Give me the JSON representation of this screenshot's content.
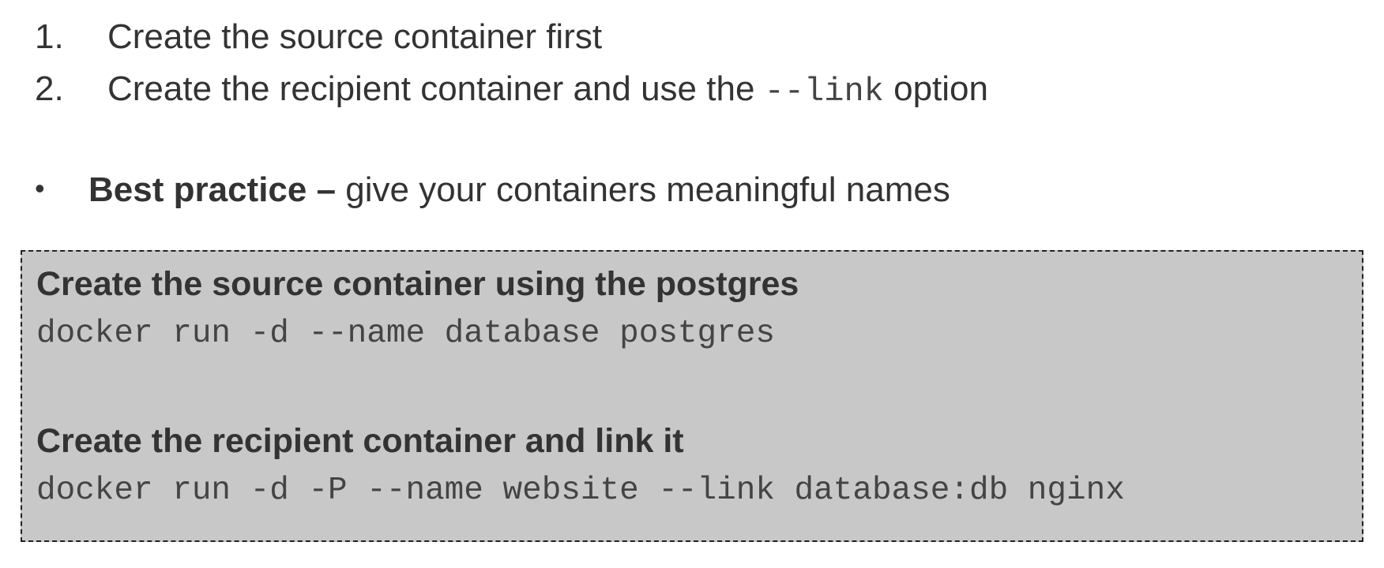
{
  "steps": [
    {
      "number": "1.",
      "text": "Create the source container first"
    },
    {
      "number": "2.",
      "text_before": "Create the recipient container and use the ",
      "code": "--link",
      "text_after": " option"
    }
  ],
  "bullet": {
    "symbol": "•",
    "bold": "Best practice –",
    "text": " give your containers meaningful names"
  },
  "code_box": {
    "blocks": [
      {
        "heading": "Create the source container using the postgres",
        "command": "docker run -d --name database postgres"
      },
      {
        "heading": "Create the recipient container and link it",
        "command": "docker run -d -P --name website --link database:db nginx"
      }
    ]
  }
}
